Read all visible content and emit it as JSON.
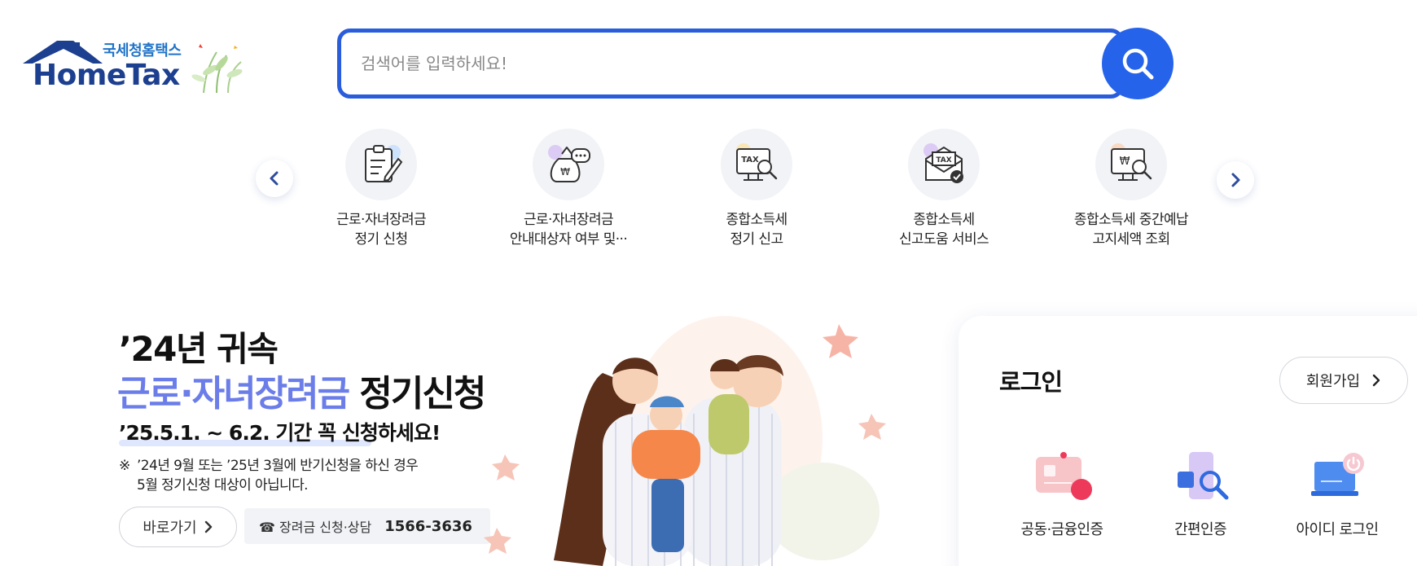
{
  "logo": {
    "sub_text": "국세청홈택스",
    "main_text": "HomeTax",
    "icon": "house-roof-icon"
  },
  "search": {
    "placeholder": "검색어를 입력하세요!",
    "value": "",
    "button_icon": "search-icon"
  },
  "quick_menu": {
    "prev_icon": "chevron-left-icon",
    "next_icon": "chevron-right-icon",
    "items": [
      {
        "line1": "근로·자녀장려금",
        "line2": "정기 신청",
        "icon": "clipboard-pen-icon"
      },
      {
        "line1": "근로·자녀장려금",
        "line2": "안내대상자 여부 및···",
        "icon": "money-bag-chat-icon"
      },
      {
        "line1": "종합소득세",
        "line2": "정기 신고",
        "icon": "tax-monitor-search-icon"
      },
      {
        "line1": "종합소득세",
        "line2": "신고도움 서비스",
        "icon": "tax-envelope-check-icon"
      },
      {
        "line1": "종합소득세 중간예납",
        "line2": "고지세액 조회",
        "icon": "won-monitor-search-icon"
      }
    ]
  },
  "banner": {
    "line1": "’24년 귀속",
    "line2_highlight": "근로·자녀장려금",
    "line2_rest": " 정기신청",
    "line3": "’25.5.1. ~ 6.2. 기간 꼭 신청하세요!",
    "note_mark": "※",
    "note_line1": "’24년 9월 또는 ’25년 3월에 반기신청을 하신 경우",
    "note_line2": "5월 정기신청 대상이 아닙니다.",
    "go_button": "바로가기",
    "contact_label": "☎ 장려금 신청·상담",
    "contact_number": "1566-3636",
    "colors": {
      "highlight": "#6b7de8",
      "accent": "#2563eb"
    }
  },
  "login": {
    "title": "로그인",
    "signup_button": "회원가입",
    "options": [
      {
        "label": "공동·금융인증",
        "icon": "certificate-card-icon"
      },
      {
        "label": "간편인증",
        "icon": "phone-magnifier-icon"
      },
      {
        "label": "아이디 로그인",
        "icon": "laptop-power-icon"
      }
    ]
  }
}
